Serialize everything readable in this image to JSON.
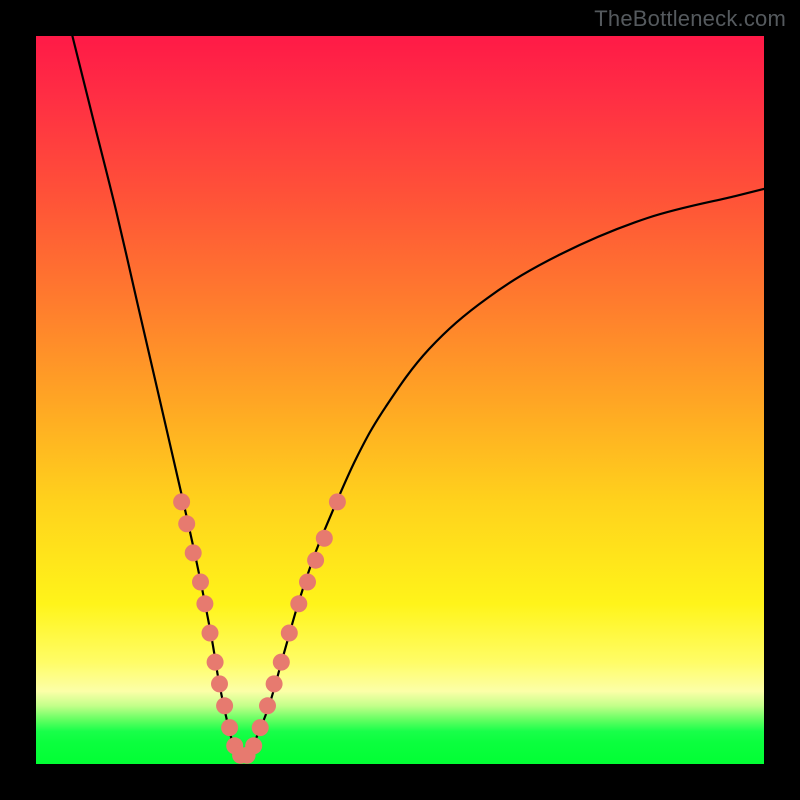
{
  "watermark": "TheBottleneck.com",
  "palette": {
    "black": "#000000",
    "dot": "#e77a6f",
    "gradient_top": "#ff1a47",
    "gradient_mid": "#ffd21c",
    "gradient_bottom": "#02ff34"
  },
  "chart_data": {
    "type": "line",
    "title": "",
    "xlabel": "",
    "ylabel": "",
    "xlim": [
      0,
      100
    ],
    "ylim": [
      0,
      100
    ],
    "grid": false,
    "legend": false,
    "series": [
      {
        "name": "bottleneck-curve",
        "x": [
          5,
          8,
          11,
          14,
          17,
          20,
          22,
          24,
          25,
          26,
          27,
          28,
          29,
          30,
          32,
          34,
          36,
          38,
          40,
          44,
          48,
          54,
          62,
          72,
          84,
          96,
          100
        ],
        "y": [
          100,
          88,
          76,
          63,
          50,
          37,
          28,
          18,
          12,
          7,
          3,
          1,
          1,
          3,
          8,
          15,
          22,
          28,
          33,
          42,
          49,
          57,
          64,
          70,
          75,
          78,
          79
        ]
      }
    ],
    "markers": [
      {
        "name": "left-cluster",
        "x": 20.0,
        "y": 36
      },
      {
        "name": "left-cluster",
        "x": 20.7,
        "y": 33
      },
      {
        "name": "left-cluster",
        "x": 21.6,
        "y": 29
      },
      {
        "name": "left-cluster",
        "x": 22.6,
        "y": 25
      },
      {
        "name": "left-cluster",
        "x": 23.2,
        "y": 22
      },
      {
        "name": "left-cluster",
        "x": 23.9,
        "y": 18
      },
      {
        "name": "left-cluster",
        "x": 24.6,
        "y": 14
      },
      {
        "name": "left-cluster",
        "x": 25.2,
        "y": 11
      },
      {
        "name": "left-cluster",
        "x": 25.9,
        "y": 8
      },
      {
        "name": "left-cluster",
        "x": 26.6,
        "y": 5
      },
      {
        "name": "bottom",
        "x": 27.3,
        "y": 2.5
      },
      {
        "name": "bottom",
        "x": 28.1,
        "y": 1.2
      },
      {
        "name": "bottom",
        "x": 29.0,
        "y": 1.2
      },
      {
        "name": "bottom",
        "x": 29.9,
        "y": 2.5
      },
      {
        "name": "right-cluster",
        "x": 30.8,
        "y": 5
      },
      {
        "name": "right-cluster",
        "x": 31.8,
        "y": 8
      },
      {
        "name": "right-cluster",
        "x": 32.7,
        "y": 11
      },
      {
        "name": "right-cluster",
        "x": 33.7,
        "y": 14
      },
      {
        "name": "right-cluster",
        "x": 34.8,
        "y": 18
      },
      {
        "name": "right-cluster",
        "x": 36.1,
        "y": 22
      },
      {
        "name": "right-cluster",
        "x": 37.3,
        "y": 25
      },
      {
        "name": "right-cluster",
        "x": 38.4,
        "y": 28
      },
      {
        "name": "right-cluster",
        "x": 39.6,
        "y": 31
      },
      {
        "name": "right-cluster",
        "x": 41.4,
        "y": 36
      }
    ]
  }
}
